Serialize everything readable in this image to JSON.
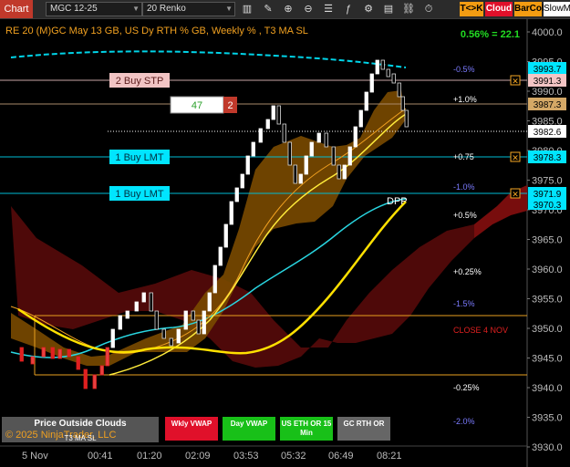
{
  "toolbar": {
    "chart_label": "Chart",
    "instrument": "MGC 12-25",
    "interval": "20 Renko",
    "tk_label": "T<>K",
    "cloud_label": "Cloud",
    "barcol_label": "BarCol",
    "slowm_label": "SlowM",
    "icons": [
      "bar-type-icon",
      "drawing-tools-icon",
      "zoom-in-icon",
      "zoom-out-icon",
      "properties-icon",
      "indicators-icon",
      "strategies-icon",
      "templates-icon",
      "instrument-link-icon",
      "interval-link-icon"
    ]
  },
  "chart": {
    "title": "RE 20  (M)GC May 13 GB, US Dy RTH % GB, Weekly % , T3 MA SL",
    "pct_readout": "0.56% = 22.1",
    "dpp_label": "DPP",
    "close_label": "CLOSE 4 NOV",
    "copyright": "© 2025 NinjaTrader, LLC",
    "t3_label": "T3 MA SL",
    "orders": [
      {
        "label": "2 Buy STP",
        "price": "3991.3",
        "price_color": "#f2c4c4"
      },
      {
        "label": "1 Buy LMT",
        "price": "3978.3",
        "price_color": "#00e5ff"
      },
      {
        "label": "1 Buy LMT",
        "price": "3971.9",
        "price_color": "#00e5ff"
      }
    ],
    "position_box": {
      "qty": "47",
      "contracts": "2"
    },
    "level_pct": [
      "-0.5%",
      "+1.0%",
      "+0.75",
      "-1.0%",
      "+0.5%",
      "+0.25%",
      "-1.5%",
      "-0.25%",
      "-2.0%"
    ],
    "price_badges": {
      "top": "3993.7",
      "target": "3987.3",
      "last": "3982.6",
      "lower": "3970.3"
    },
    "y_axis": [
      "4000.0",
      "3995.0",
      "3990.0",
      "3985.0",
      "3980.0",
      "3975.0",
      "3970.0",
      "3965.0",
      "3960.0",
      "3955.0",
      "3950.0",
      "3945.0",
      "3940.0",
      "3935.0",
      "3930.0"
    ],
    "x_axis": [
      "5 Nov",
      "00:41",
      "01:20",
      "02:09",
      "03:53",
      "05:32",
      "06:49",
      "08:21"
    ],
    "legend_buttons": {
      "outside": "Price Outside Clouds",
      "wkly": "Wkly VWAP",
      "day": "Day VWAP",
      "us_eth": "US ETH OR 15 Min",
      "gc_rth": "GC RTH OR"
    }
  }
}
